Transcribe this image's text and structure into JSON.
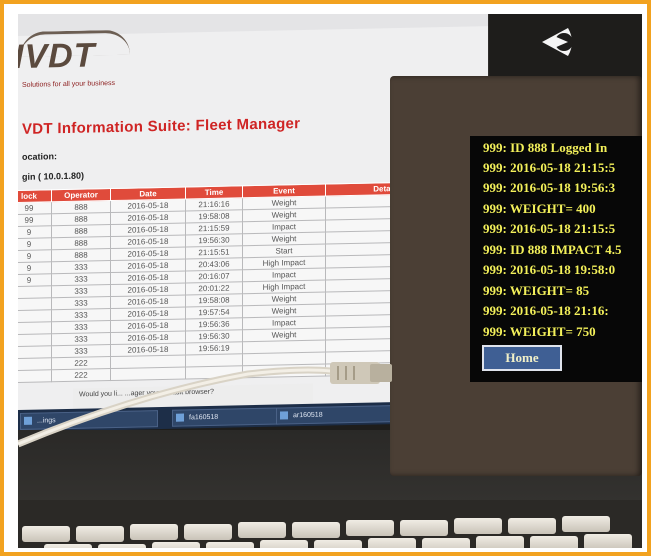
{
  "laptop": {
    "logo": "IVDT",
    "tagline": "Solutions for all your business",
    "title": "VDT Information Suite: Fleet Manager",
    "location_label": "ocation:",
    "login_label": "gin ( 10.0.1.80)",
    "table": {
      "columns": [
        "lock",
        "Operator",
        "Date",
        "Time",
        "Event",
        "Detai"
      ],
      "rows": [
        [
          "99",
          "888",
          "2016-05-18",
          "21:16:16",
          "Weight",
          ""
        ],
        [
          "99",
          "888",
          "2016-05-18",
          "19:58:08",
          "Weight",
          ""
        ],
        [
          "9",
          "888",
          "2016-05-18",
          "21:15:59",
          "Impact",
          ""
        ],
        [
          "9",
          "888",
          "2016-05-18",
          "19:56:30",
          "Weight",
          ""
        ],
        [
          "9",
          "888",
          "2016-05-18",
          "21:15:51",
          "Start",
          ""
        ],
        [
          "9",
          "333",
          "2016-05-18",
          "20:43:06",
          "High Impact",
          ""
        ],
        [
          "9",
          "333",
          "2016-05-18",
          "20:16:07",
          "Impact",
          ""
        ],
        [
          "",
          "333",
          "2016-05-18",
          "20:01:22",
          "High Impact",
          ""
        ],
        [
          "",
          "333",
          "2016-05-18",
          "19:58:08",
          "Weight",
          ""
        ],
        [
          "",
          "333",
          "2016-05-18",
          "19:57:54",
          "Weight",
          ""
        ],
        [
          "",
          "333",
          "2016-05-18",
          "19:56:36",
          "Impact",
          ""
        ],
        [
          "",
          "333",
          "2016-05-18",
          "19:56:30",
          "Weight",
          ""
        ],
        [
          "",
          "333",
          "2016-05-18",
          "19:56:19",
          "",
          ""
        ],
        [
          "",
          "222",
          "",
          "",
          "",
          ""
        ],
        [
          "",
          "222",
          "",
          "",
          "",
          ""
        ]
      ]
    },
    "prompt_text": "Would you li...            ...ager your default browser?",
    "taskbar": [
      "...ings",
      "fa160518",
      "ar160518"
    ]
  },
  "device": {
    "lines": [
      "999: ID 888 Logged In",
      "999: 2016-05-18 21:15:5",
      "999: 2016-05-18 19:56:3",
      "999: WEIGHT= 400",
      "999: 2016-05-18 21:15:5",
      "999: ID 888 IMPACT 4.5",
      "999: 2016-05-18 19:58:0",
      "999: WEIGHT= 85",
      "999: 2016-05-18 21:16:",
      "999: WEIGHT= 750"
    ],
    "home_label": "Home"
  },
  "colors": {
    "frame": "#f2a21f",
    "title_red": "#cf2424",
    "header_red": "#e04b3b",
    "screen_text": "#f3f05a",
    "home_button": "#3f5f94"
  }
}
